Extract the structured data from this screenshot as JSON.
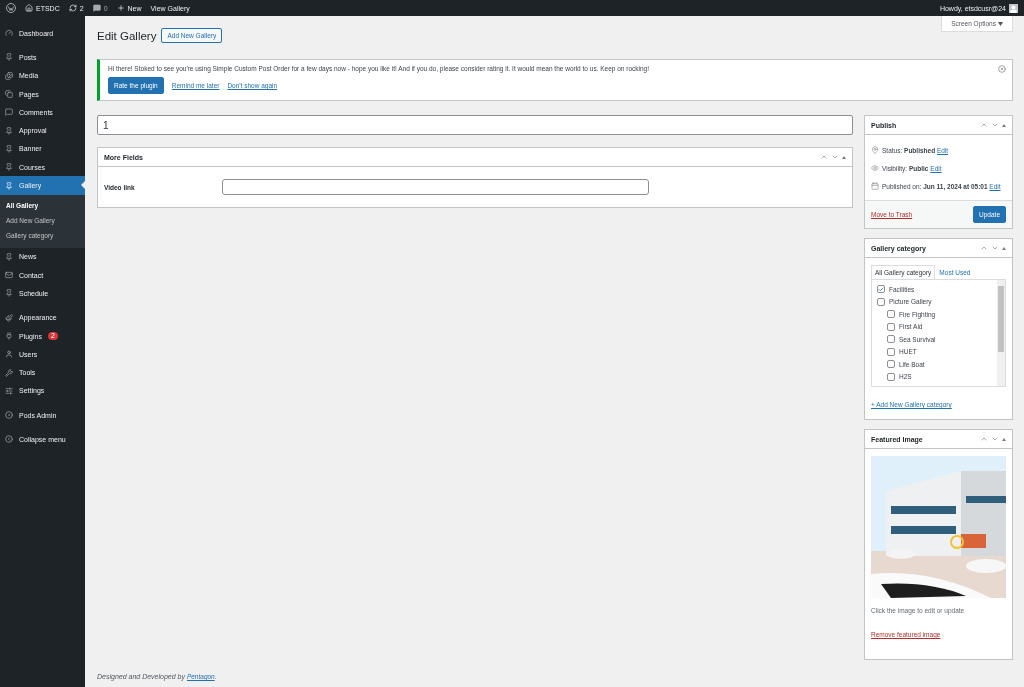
{
  "admin_bar": {
    "site": "ETSDC",
    "updates": "2",
    "comments": "0",
    "new": "New",
    "view": "View Gallery",
    "greeting": "Howdy, etsdcusr@24"
  },
  "sidebar": {
    "items": [
      {
        "label": "Dashboard",
        "selected": false
      },
      {
        "label": "Posts",
        "selected": false
      },
      {
        "label": "Media",
        "selected": false
      },
      {
        "label": "Pages",
        "selected": false
      },
      {
        "label": "Comments",
        "selected": false
      },
      {
        "label": "Approval",
        "selected": false
      },
      {
        "label": "Banner",
        "selected": false
      },
      {
        "label": "Courses",
        "selected": false
      },
      {
        "label": "Gallery",
        "selected": true,
        "submenu": [
          {
            "label": "All Gallery",
            "selected": true
          },
          {
            "label": "Add New Gallery",
            "selected": false
          },
          {
            "label": "Gallery category",
            "selected": false
          }
        ]
      },
      {
        "label": "News",
        "selected": false
      },
      {
        "label": "Contact",
        "selected": false
      },
      {
        "label": "Schedule",
        "selected": false
      },
      {
        "label": "Appearance",
        "selected": false
      },
      {
        "label": "Plugins",
        "selected": false,
        "badge": "2"
      },
      {
        "label": "Users",
        "selected": false
      },
      {
        "label": "Tools",
        "selected": false
      },
      {
        "label": "Settings",
        "selected": false
      },
      {
        "label": "Pods Admin",
        "selected": false
      },
      {
        "label": "Collapse menu",
        "selected": false
      }
    ]
  },
  "screen_options": "Screen Options",
  "page_title": "Edit Gallery",
  "add_new_button": "Add New Gallery",
  "notice": {
    "message": "Hi there! Stoked to see you're using Simple Custom Post Order for a few days now - hope you like it! And if you do, please consider rating it. It would mean the world to us. Keep on rocking!",
    "rate_button": "Rate the plugin",
    "remind_link": "Remind me later",
    "dismiss_link": "Don't show again"
  },
  "post_title": "1",
  "more_fields": {
    "title": "More Fields",
    "fields": [
      {
        "label": "Video link"
      }
    ]
  },
  "publish": {
    "title": "Publish",
    "rows": [
      {
        "label": "Status:",
        "value": "Published",
        "link": "Edit"
      },
      {
        "label": "Visibility:",
        "value": "Public",
        "link": "Edit"
      },
      {
        "label": "Published on:",
        "value": "Jun 11, 2024 at 05:01",
        "link": "Edit"
      }
    ],
    "trash_link": "Move to Trash",
    "update_button": "Update"
  },
  "gallery_category": {
    "title": "Gallery category",
    "tabs": [
      {
        "label": "All Gallery category",
        "selected": true
      },
      {
        "label": "Most Used",
        "selected": false
      }
    ],
    "categories": [
      {
        "label": "Facilities",
        "checked": true
      },
      {
        "label": "Picture Gallery",
        "checked": false,
        "children": [
          {
            "label": "Fire Fighting",
            "checked": false
          },
          {
            "label": "First Aid",
            "checked": false
          },
          {
            "label": "Sea Survival",
            "checked": false
          },
          {
            "label": "HUET",
            "checked": false
          },
          {
            "label": "Life Boat",
            "checked": false
          },
          {
            "label": "H2S",
            "checked": false
          }
        ]
      }
    ],
    "add_link": "+ Add New Gallery category"
  },
  "featured_image": {
    "title": "Featured Image",
    "hint": "Click the image to edit or update",
    "remove_link": "Remove featured image"
  },
  "footer": {
    "text": "Designed and Developed by",
    "link": "Pentagon",
    "tail": "."
  }
}
